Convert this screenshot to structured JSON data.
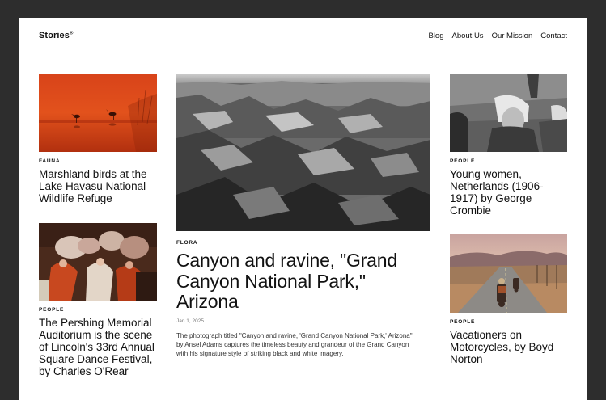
{
  "site": {
    "logo": "Stories",
    "logo_mark": "®"
  },
  "nav": {
    "items": [
      "Blog",
      "About Us",
      "Our Mission",
      "Contact"
    ]
  },
  "left": {
    "card1": {
      "category": "FAUNA",
      "title": "Marshland birds at the Lake Havasu National Wildlife Refuge"
    },
    "card2": {
      "category": "PEOPLE",
      "title": "The Pershing Memorial Auditorium is the scene of Lincoln's 33rd Annual Square Dance Festival, by Charles O'Rear"
    }
  },
  "feature": {
    "category": "FLORA",
    "title": "Canyon and ravine, \"Grand Canyon National Park,\" Arizona",
    "date": "Jan 1, 2025",
    "excerpt": "The photograph titled \"Canyon and ravine, 'Grand Canyon National Park,' Arizona\" by Ansel Adams captures the timeless beauty and grandeur of the Grand Canyon with his signature style of striking black and white imagery."
  },
  "right": {
    "card1": {
      "category": "PEOPLE",
      "title": "Young women, Netherlands (1906-1917) by George Crombie"
    },
    "card2": {
      "category": "PEOPLE",
      "title": "Vacationers on Motorcycles, by Boyd Norton"
    }
  }
}
